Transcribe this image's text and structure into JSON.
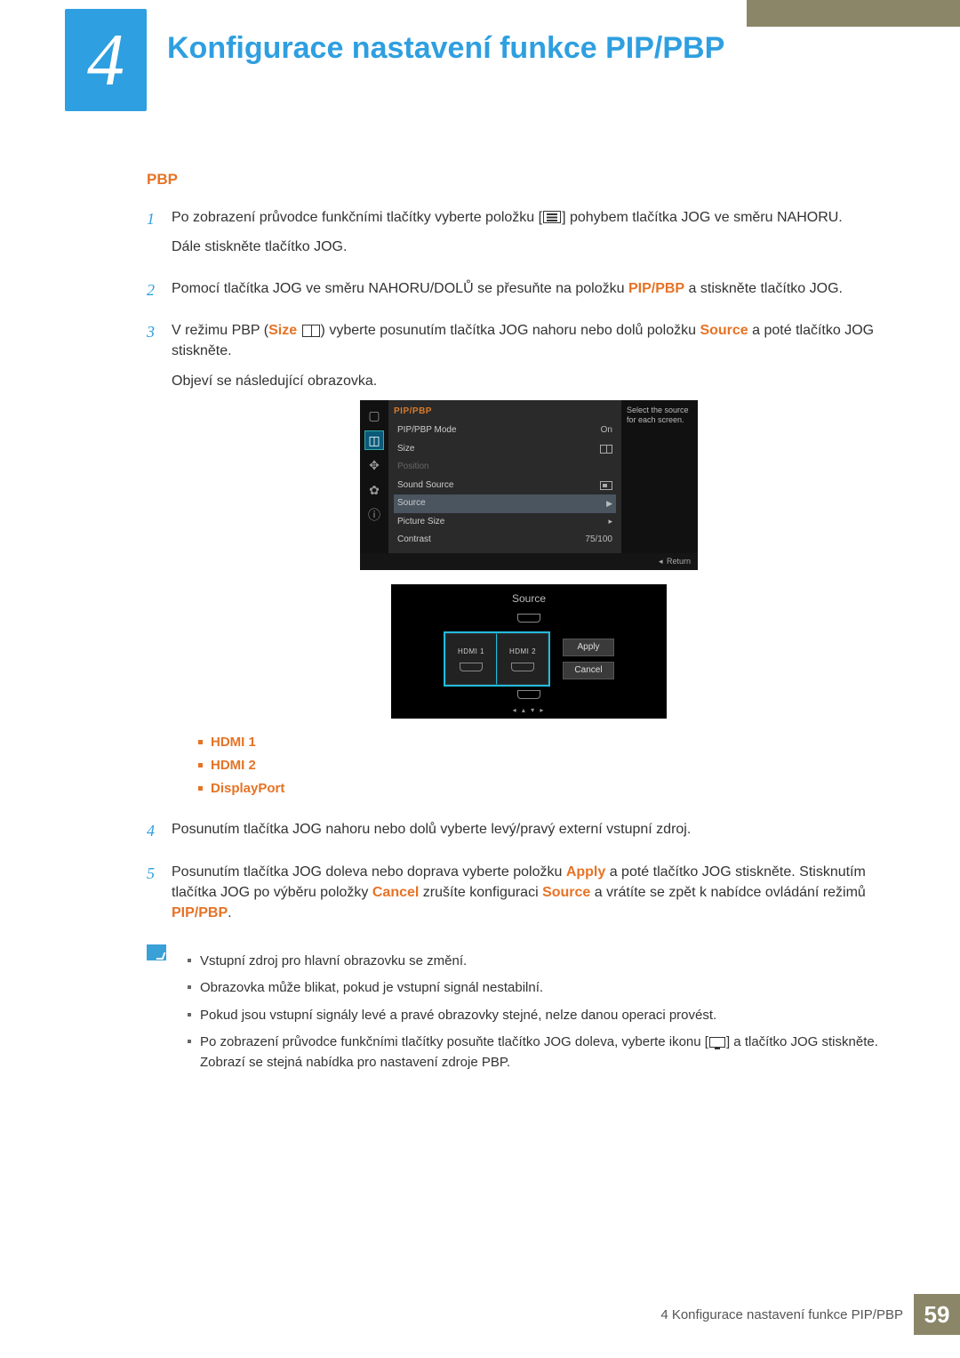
{
  "chapter": {
    "num": "4",
    "title": "Konfigurace nastavení funkce PIP/PBP"
  },
  "section": {
    "heading": "PBP"
  },
  "steps": {
    "s1": {
      "a": "Po zobrazení průvodce funkčními tlačítky vyberte položku [",
      "b": "] pohybem tlačítka JOG ve směru NAHORU.",
      "c": "Dále stiskněte tlačítko JOG."
    },
    "s2": {
      "a": "Pomocí tlačítka JOG ve směru NAHORU/DOLŮ se přesuňte na položku ",
      "kw1": "PIP/PBP",
      "b": " a stiskněte tlačítko JOG."
    },
    "s3": {
      "a": "V režimu PBP (",
      "kw1": "Size",
      "b": ") vyberte posunutím tlačítka JOG nahoru nebo dolů položku ",
      "kw2": "Source",
      "c": " a poté tlačítko JOG stiskněte.",
      "d": "Objeví se následující obrazovka."
    },
    "s4": {
      "a": "Posunutím tlačítka JOG nahoru nebo dolů vyberte levý/pravý externí vstupní zdroj."
    },
    "s5": {
      "a": "Posunutím tlačítka JOG doleva nebo doprava vyberte položku ",
      "kw1": "Apply",
      "b": " a poté tlačítko JOG stiskněte. Stisknutím tlačítka JOG po výběru položky ",
      "kw2": "Cancel",
      "c": " zrušíte konfiguraci ",
      "kw3": "Source",
      "d": " a vrátíte se zpět k nabídce ovládání režimů ",
      "kw4": "PIP/PBP",
      "e": "."
    }
  },
  "osd1": {
    "title": "PIP/PBP",
    "rows": {
      "mode": {
        "label": "PIP/PBP Mode",
        "value": "On"
      },
      "size": {
        "label": "Size"
      },
      "position": {
        "label": "Position"
      },
      "sound": {
        "label": "Sound Source"
      },
      "source": {
        "label": "Source"
      },
      "psize": {
        "label": "Picture Size"
      },
      "contrast": {
        "label": "Contrast",
        "value": "75/100"
      }
    },
    "help": "Select the source for each screen.",
    "return": "Return"
  },
  "osd2": {
    "title": "Source",
    "left": "HDMI 1",
    "right": "HDMI 2",
    "apply": "Apply",
    "cancel": "Cancel"
  },
  "sources": {
    "a": "HDMI 1",
    "b": "HDMI 2",
    "c": "DisplayPort"
  },
  "notes": {
    "n1": "Vstupní zdroj pro hlavní obrazovku se změní.",
    "n2": "Obrazovka může blikat, pokud je vstupní signál nestabilní.",
    "n3": "Pokud jsou vstupní signály levé a pravé obrazovky stejné, nelze danou operaci provést.",
    "n4a": "Po zobrazení průvodce funkčními tlačítky posuňte tlačítko JOG doleva, vyberte ikonu [",
    "n4b": "] a tlačítko JOG stiskněte. Zobrazí se stejná nabídka pro nastavení zdroje PBP."
  },
  "footer": {
    "text": "4 Konfigurace nastavení funkce PIP/PBP",
    "page": "59"
  }
}
